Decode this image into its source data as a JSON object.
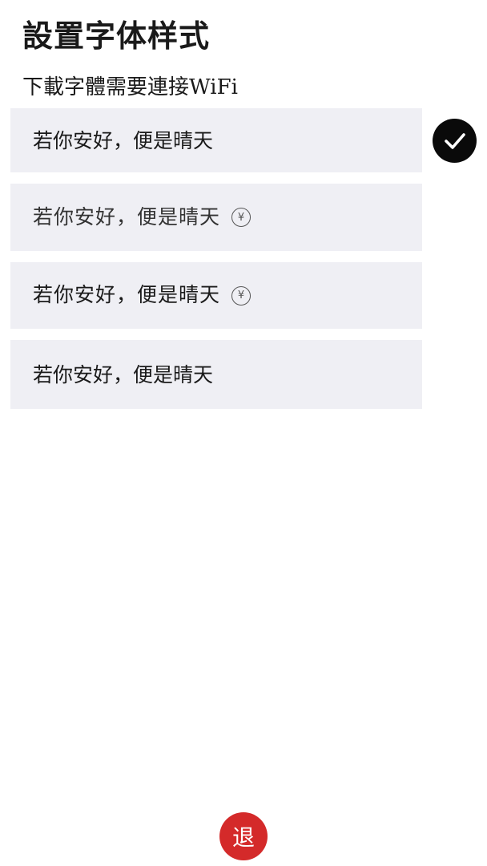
{
  "header": {
    "title": "設置字体样式",
    "subtitle": "下載字體需要連接WiFi"
  },
  "font_options": [
    {
      "label": "若你安好，便是晴天",
      "selected": true,
      "paid": false
    },
    {
      "label": "若你安好，便是晴天",
      "selected": false,
      "paid": true,
      "price_icon": "¥"
    },
    {
      "label": "若你安好，便是晴天",
      "selected": false,
      "paid": true,
      "price_icon": "¥"
    },
    {
      "label": "若你安好，便是晴天",
      "selected": false,
      "paid": false
    }
  ],
  "icons": {
    "selected": "check-icon",
    "price": "yuan-icon"
  },
  "exit_button": {
    "label": "退",
    "color": "#d42a2a"
  },
  "colors": {
    "option_background": "#efeff4",
    "check_background": "#0a0a0a"
  }
}
